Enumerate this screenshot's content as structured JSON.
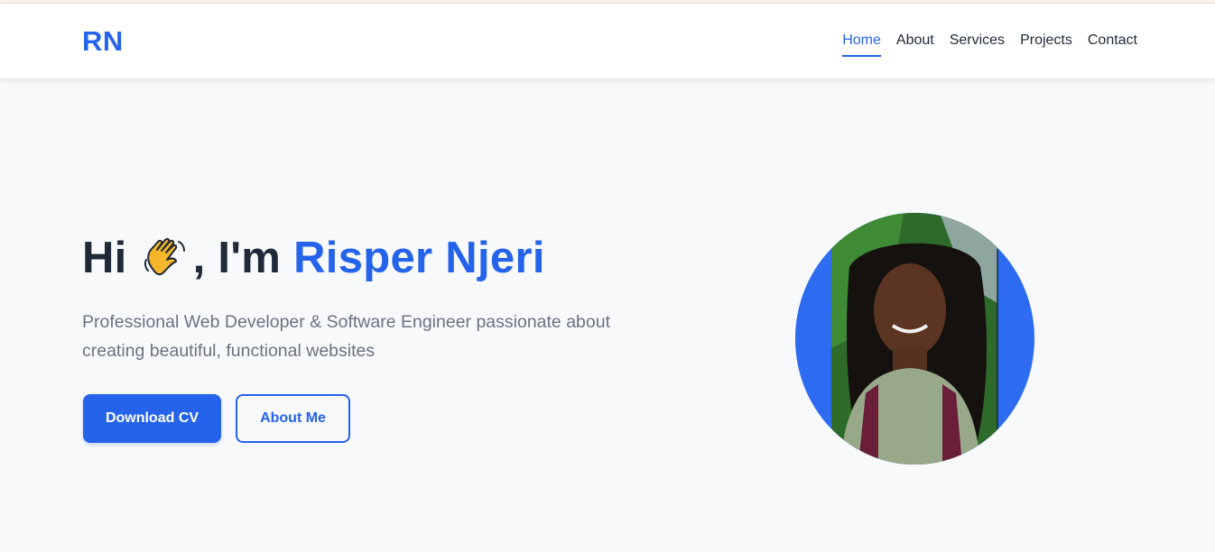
{
  "header": {
    "logo": "RN",
    "nav": [
      {
        "label": "Home",
        "active": true
      },
      {
        "label": "About"
      },
      {
        "label": "Services"
      },
      {
        "label": "Projects"
      },
      {
        "label": "Contact"
      }
    ]
  },
  "hero": {
    "greeting": "Hi",
    "wave_icon": "waving-hand-icon",
    "intro": ", I'm",
    "name": "Risper Njeri",
    "subtitle": "Professional Web Developer & Software Engineer passionate about creating beautiful, functional websites",
    "primary_button": "Download CV",
    "secondary_button": "About Me"
  },
  "colors": {
    "accent": "#2563eb",
    "text": "#1f2937",
    "muted": "#6b7280",
    "background": "#f8f9fb"
  }
}
